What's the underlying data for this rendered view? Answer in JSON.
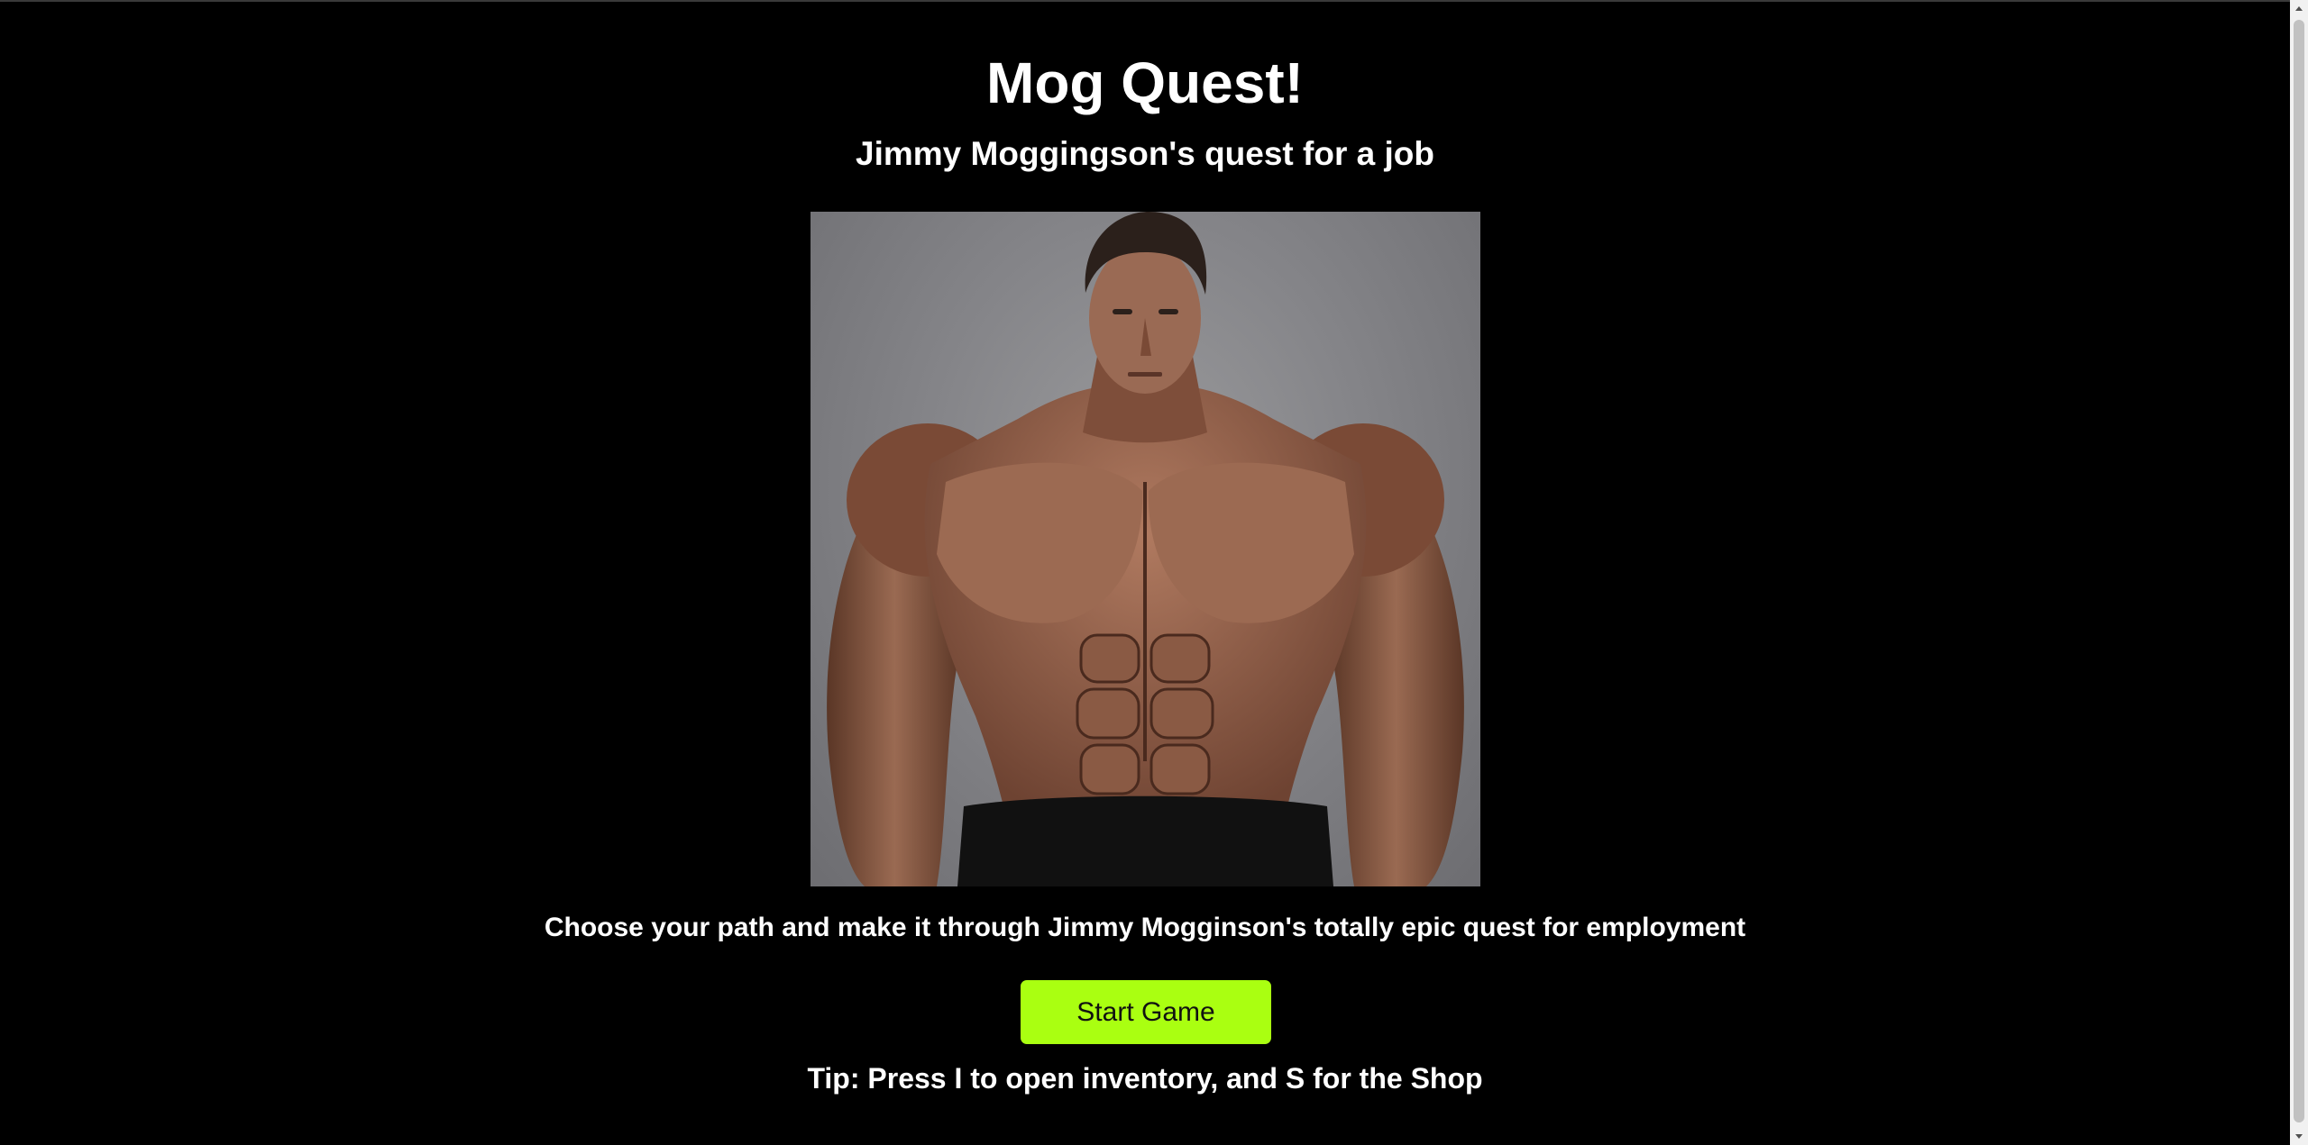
{
  "game": {
    "title": "Mog Quest!",
    "subtitle": "Jimmy Moggingson's quest for a job",
    "hero_image": "muscular-man-portrait",
    "description": "Choose your path and make it through Jimmy Mogginson's totally epic quest for employment",
    "start_button_label": "Start Game",
    "tip": "Tip: Press I to open inventory, and S for the Shop"
  },
  "colors": {
    "background": "#000000",
    "text": "#ffffff",
    "start_button": "#aaff11"
  }
}
